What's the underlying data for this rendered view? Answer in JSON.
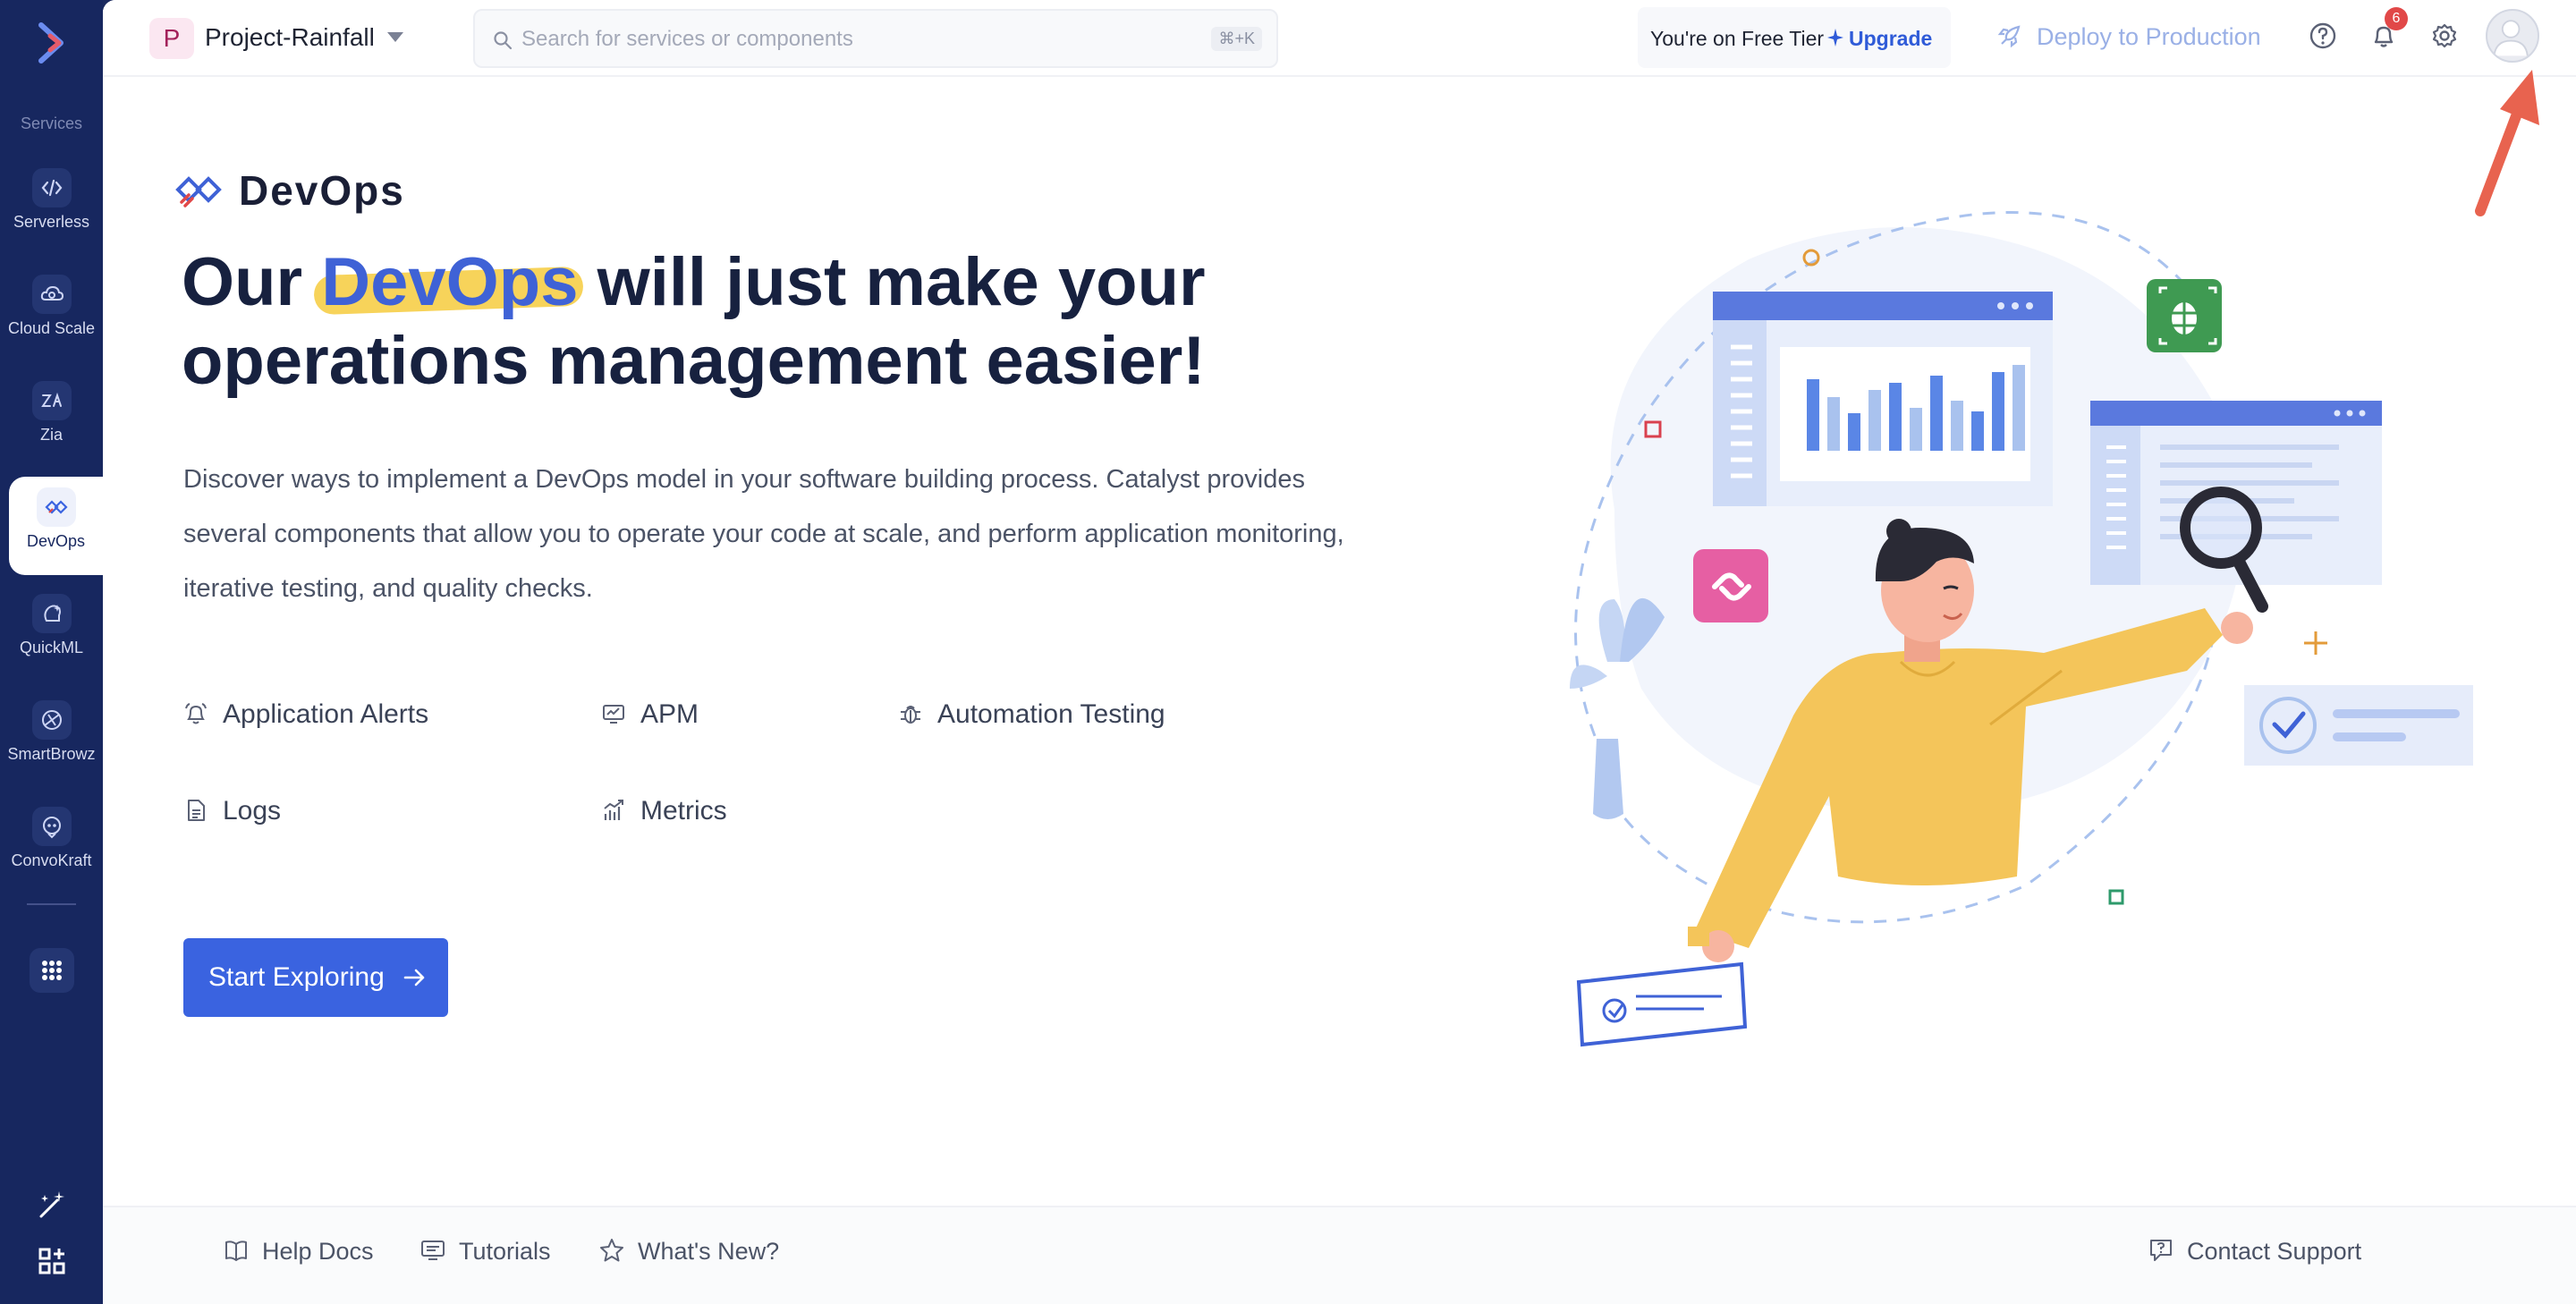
{
  "sidebar": {
    "section_label": "Services",
    "items": [
      {
        "label": "Serverless",
        "icon": "serverless-icon"
      },
      {
        "label": "Cloud Scale",
        "icon": "cloud-scale-icon"
      },
      {
        "label": "Zia",
        "icon": "zia-icon"
      },
      {
        "label": "DevOps",
        "icon": "devops-icon",
        "active": true
      },
      {
        "label": "QuickML",
        "icon": "quickml-icon"
      },
      {
        "label": "SmartBrowz",
        "icon": "smartbrowz-icon"
      },
      {
        "label": "ConvoKraft",
        "icon": "convokraft-icon"
      }
    ]
  },
  "header": {
    "project_initial": "P",
    "project_name": "Project-Rainfall",
    "search_placeholder": "Search for services or components",
    "search_shortcut": "⌘+K",
    "tier_text": "You're on Free Tier",
    "upgrade_label": "Upgrade",
    "deploy_label": "Deploy to Production",
    "notification_count": "6"
  },
  "hero": {
    "brand_name": "DevOps",
    "title_pre": "Our ",
    "title_highlight": "DevOps",
    "title_post": " will just make your operations management easier!",
    "description": "Discover ways to implement a DevOps model in your software building process. Catalyst provides several components that allow you to operate your code at scale, and perform application monitoring, iterative testing, and quality checks.",
    "features": [
      {
        "label": "Application Alerts",
        "icon": "alert-bell-icon"
      },
      {
        "label": "APM",
        "icon": "apm-monitor-icon"
      },
      {
        "label": "Automation Testing",
        "icon": "bug-icon"
      },
      {
        "label": "Logs",
        "icon": "document-icon"
      },
      {
        "label": "Metrics",
        "icon": "metrics-chart-icon"
      }
    ],
    "cta_label": "Start Exploring"
  },
  "footer": {
    "help_docs": "Help Docs",
    "tutorials": "Tutorials",
    "whats_new": "What's New?",
    "contact_support": "Contact Support"
  },
  "colors": {
    "sidebar_bg": "#17275f",
    "accent": "#3a63e0",
    "highlight": "#f7d35a",
    "badge": "#e14848"
  }
}
